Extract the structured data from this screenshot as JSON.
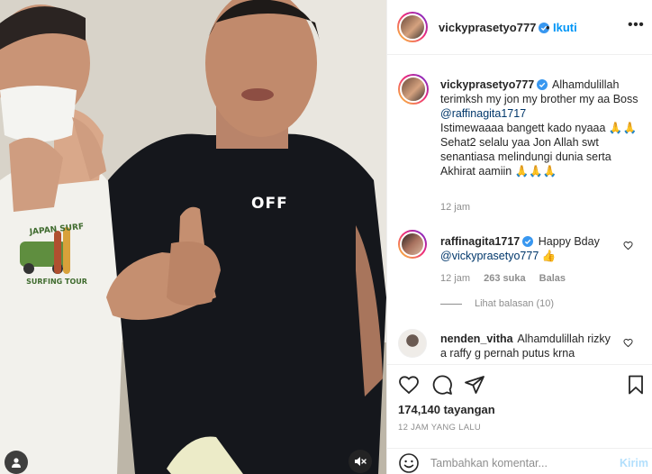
{
  "post": {
    "author": "vickyprasetyo777",
    "follow_label": "Ikuti",
    "separator": "•",
    "more_label": "•••"
  },
  "media": {
    "shirt_text": "OFF",
    "tee_print_top": "JAPAN SURF",
    "tee_print_bottom": "SURFING TOUR"
  },
  "caption": {
    "username": "vickyprasetyo777",
    "lines": [
      "Alhamdulillah terimksh my jon my brother my aa Boss",
      "@raffinagita1717",
      "Istimewaaaa bangett kado nyaaa 🙏🙏",
      "Sehat2 selalu yaa Jon Allah swt senantiasa melindungi dunia serta Akhirat aamiin 🙏🙏🙏"
    ],
    "time": "12 jam"
  },
  "comments": [
    {
      "username": "raffinagita1717",
      "text": "Happy Bday",
      "mention": "@vickyprasetyo777",
      "suffix": "👍",
      "time": "12 jam",
      "likes": "263 suka",
      "reply_label": "Balas",
      "view_replies": "Lihat balasan (10)"
    },
    {
      "username": "nenden_vitha",
      "text": "Alhamdulillah rizky a raffy g pernah putus krna"
    }
  ],
  "stats": {
    "views": "174,140 tayangan",
    "ago": "12 JAM YANG LALU"
  },
  "composer": {
    "placeholder": "Tambahkan komentar...",
    "post_label": "Kirim"
  },
  "colors": {
    "accent": "#0095f6",
    "verified": "#3897f0",
    "muted": "#8e8e8e"
  },
  "icons": [
    "user-tag-icon",
    "mute-icon",
    "verified-icon",
    "heart-icon",
    "comment-icon",
    "share-icon",
    "bookmark-icon",
    "emoji-icon"
  ]
}
